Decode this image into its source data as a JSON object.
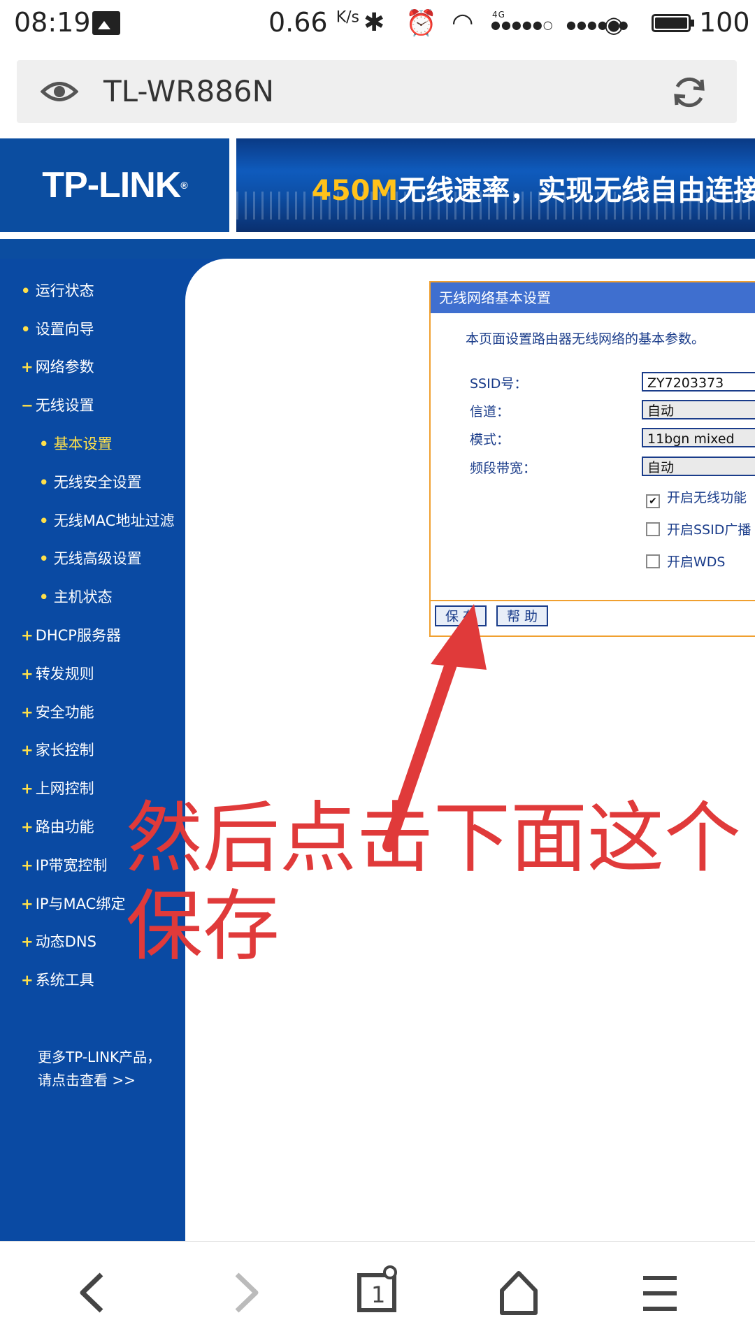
{
  "status_bar": {
    "time": "08:19",
    "speed": "0.66",
    "speed_unit": "K/s",
    "signal_4g_label": "4G",
    "battery": "100"
  },
  "url_bar": {
    "url": "TL-WR886N"
  },
  "banner": {
    "logo": "TP-LINK",
    "ad_highlight": "450M",
    "ad_text": "无线速率，实现无线自由连接"
  },
  "sidebar": {
    "items": [
      {
        "label": "运行状态",
        "marker": "•"
      },
      {
        "label": "设置向导",
        "marker": "•"
      },
      {
        "label": "网络参数",
        "marker": "+"
      },
      {
        "label": "无线设置",
        "marker": "−"
      },
      {
        "label": "基本设置",
        "marker": "•"
      },
      {
        "label": "无线安全设置",
        "marker": "•"
      },
      {
        "label": "无线MAC地址过滤",
        "marker": "•"
      },
      {
        "label": "无线高级设置",
        "marker": "•"
      },
      {
        "label": "主机状态",
        "marker": "•"
      },
      {
        "label": "DHCP服务器",
        "marker": "+"
      },
      {
        "label": "转发规则",
        "marker": "+"
      },
      {
        "label": "安全功能",
        "marker": "+"
      },
      {
        "label": "家长控制",
        "marker": "+"
      },
      {
        "label": "上网控制",
        "marker": "+"
      },
      {
        "label": "路由功能",
        "marker": "+"
      },
      {
        "label": "IP带宽控制",
        "marker": "+"
      },
      {
        "label": "IP与MAC绑定",
        "marker": "+"
      },
      {
        "label": "动态DNS",
        "marker": "+"
      },
      {
        "label": "系统工具",
        "marker": "+"
      }
    ],
    "more_line1": "更多TP-LINK产品，",
    "more_line2": "请点击查看 >>"
  },
  "panel": {
    "title": "无线网络基本设置",
    "description": "本页面设置路由器无线网络的基本参数。",
    "ssid_label": "SSID号：",
    "ssid_value": "ZY7203373",
    "channel_label": "信道：",
    "channel_value": "自动",
    "mode_label": "模式：",
    "mode_value": "11bgn mixed",
    "bandwidth_label": "频段带宽：",
    "bandwidth_value": "自动",
    "check_wireless": "开启无线功能",
    "check_wireless_checked": true,
    "check_ssid": "开启SSID广播",
    "check_ssid_checked": false,
    "check_wds": "开启WDS",
    "check_wds_checked": false,
    "save_button": "保 存",
    "help_button": "帮 助"
  },
  "annotation": {
    "text": "然后点击下面这个保存",
    "color": "#e03a3a"
  },
  "colors": {
    "sidebar_bg": "#0a4aa3",
    "panel_title_bg": "#3f6fcf",
    "panel_border": "#f0a030",
    "menu_highlight": "#ffe04a"
  }
}
